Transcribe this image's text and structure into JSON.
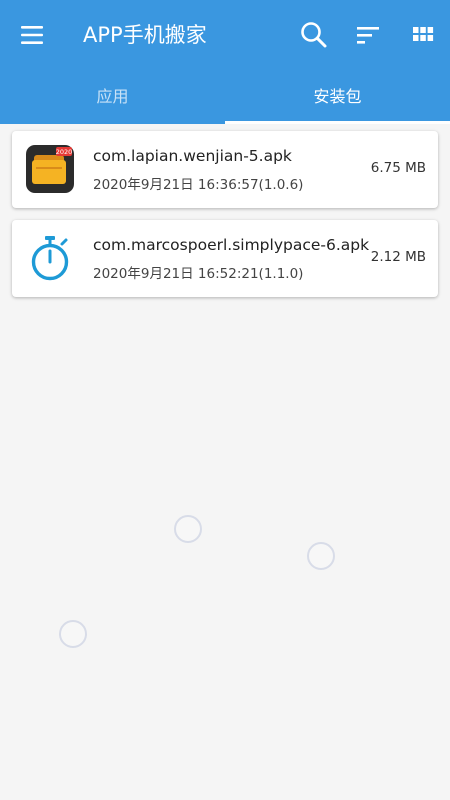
{
  "app": {
    "title": "APP手机搬家",
    "accent_color": "#3a97e0"
  },
  "toolbar": {
    "menu_icon": "hamburger-menu-icon",
    "search_icon": "search-icon",
    "sort_icon": "sort-icon",
    "grid_icon": "grid-view-icon"
  },
  "tabs": [
    {
      "label": "应用",
      "selected": false
    },
    {
      "label": "安装包",
      "selected": true
    }
  ],
  "packages": [
    {
      "name": "com.lapian.wenjian-5.apk",
      "date": "2020年9月21日 16:36:57(1.0.6)",
      "size": "6.75 MB",
      "icon": "file-manager-folder-icon",
      "icon_badge": "2020"
    },
    {
      "name": "com.marcospoerl.simplypace-6.apk",
      "date": "2020年9月21日 16:52:21(1.1.0)",
      "size": "2.12 MB",
      "icon": "stopwatch-icon"
    }
  ]
}
